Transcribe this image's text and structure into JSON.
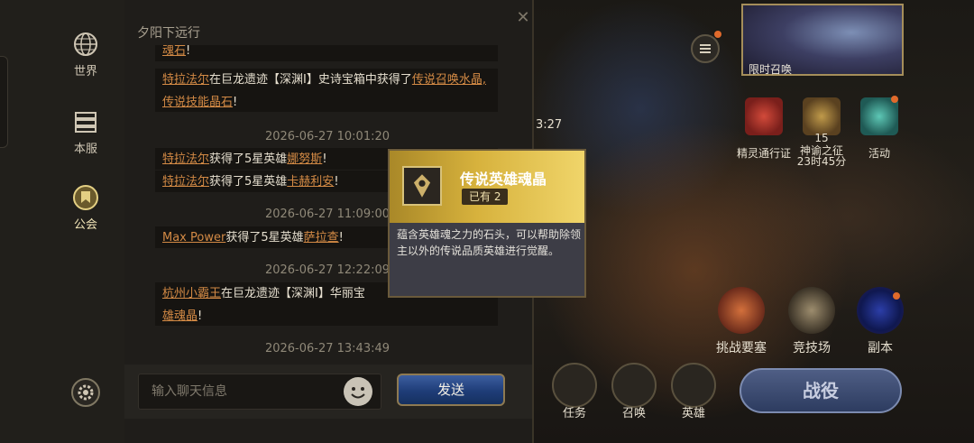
{
  "chat": {
    "channel_title": "夕阳下远行",
    "sidebar": [
      {
        "label": "世界",
        "icon": "globe-icon"
      },
      {
        "label": "本服",
        "icon": "server-icon"
      },
      {
        "label": "公会",
        "icon": "guild-icon"
      }
    ],
    "messages": [
      {
        "parts": [
          "魂石",
          "!"
        ]
      },
      {
        "player": "特拉法尔",
        "text1": "在巨龙遗迹【深渊Ⅰ】史诗宝箱中获得了",
        "item": "传说召唤水晶,传说技能晶石",
        "text2": "!"
      },
      {
        "timestamp": "2026-06-27 10:01:20"
      },
      {
        "player": "特拉法尔",
        "text1": "获得了5星英雄",
        "item": "娜努斯",
        "text2": "!"
      },
      {
        "player": "特拉法尔",
        "text1": "获得了5星英雄",
        "item": "卡赫利安",
        "text2": "!"
      },
      {
        "timestamp": "2026-06-27 11:09:00"
      },
      {
        "player": "Max Power",
        "text1": "获得了5星英雄",
        "item": "萨拉查",
        "text2": "!"
      },
      {
        "timestamp": "2026-06-27 12:22:09"
      },
      {
        "player": "杭州小霸王",
        "text1": "在巨龙遗迹【深渊Ⅰ】华丽宝",
        "item": "雄魂晶",
        "text2": "!"
      },
      {
        "timestamp": "2026-06-27 13:43:49"
      }
    ],
    "input_placeholder": "输入聊天信息",
    "send_label": "发送"
  },
  "tooltip": {
    "title": "传说英雄魂晶",
    "owned": "已有 2",
    "description": "蕴含英雄魂之力的石头，可以帮助除领主以外的传说品质英雄进行觉醒。"
  },
  "game": {
    "banner_label": "限时召唤",
    "timer_partial": "3:27",
    "events": [
      {
        "label": "精灵通行证"
      },
      {
        "label": "神谕之征",
        "count": "15",
        "timer": "23时45分"
      },
      {
        "label": "活动"
      }
    ],
    "modes": [
      {
        "label": "挑战要塞"
      },
      {
        "label": "竞技场"
      },
      {
        "label": "副本"
      }
    ],
    "nav": [
      {
        "label": "任务"
      },
      {
        "label": "召唤"
      },
      {
        "label": "英雄"
      }
    ],
    "battle_label": "战役"
  }
}
